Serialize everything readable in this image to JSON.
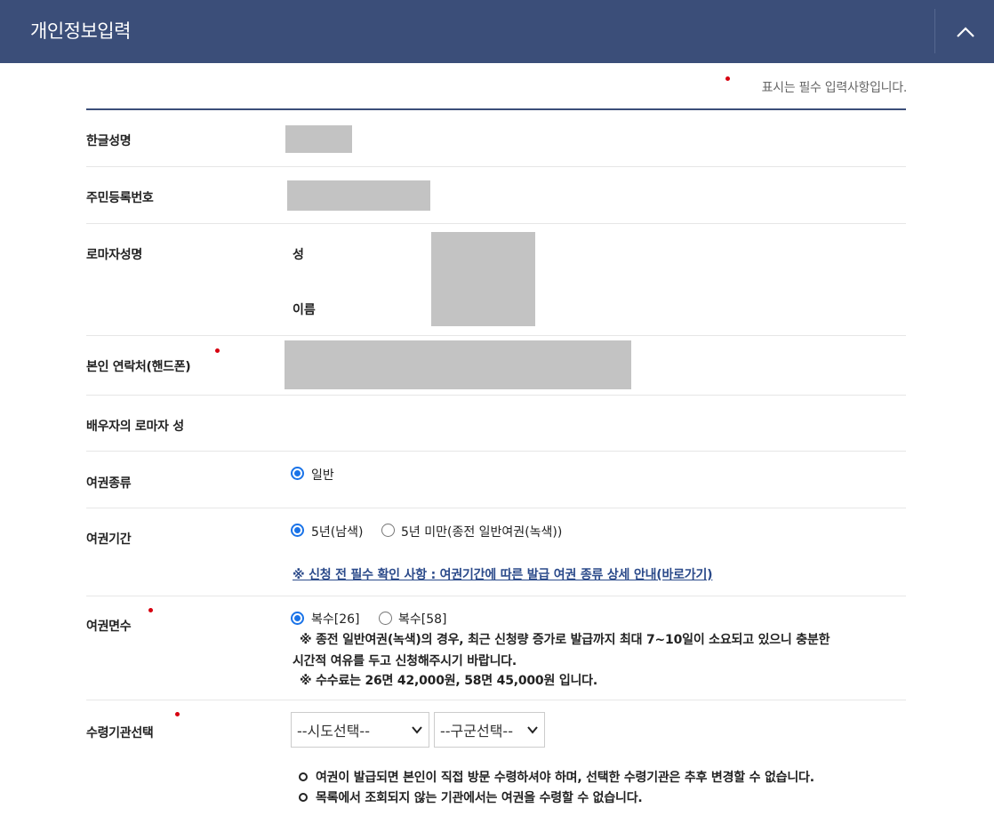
{
  "header": {
    "title": "개인정보입력"
  },
  "required_note": "표시는 필수 입력사항입니다.",
  "fields": {
    "korean_name": {
      "label": "한글성명"
    },
    "resident_number": {
      "label": "주민등록번호"
    },
    "roman_name": {
      "label": "로마자성명",
      "surname_label": "성",
      "given_label": "이름"
    },
    "phone": {
      "label": "본인 연락처(핸드폰)"
    },
    "spouse_surname": {
      "label": "배우자의 로마자 성"
    },
    "passport_type": {
      "label": "여권종류",
      "options": [
        {
          "label": "일반",
          "selected": true
        }
      ]
    },
    "passport_period": {
      "label": "여권기간",
      "options": [
        {
          "label": "5년(남색)",
          "selected": true
        },
        {
          "label": "5년 미만(종전 일반여권(녹색))",
          "selected": false
        }
      ],
      "link": "※ 신청 전 필수 확인 사항 : 여권기간에 따른 발급 여권 종류 상세 안내(바로가기)"
    },
    "page_count": {
      "label": "여권면수",
      "options": [
        {
          "label": "복수[26]",
          "selected": true
        },
        {
          "label": "복수[58]",
          "selected": false
        }
      ],
      "notes": [
        "※ 종전 일반여권(녹색)의 경우, 최근 신청량 증가로 발급까지 최대 7~10일이 소요되고 있으니 충분한",
        "시간적 여유를 두고 신청해주시기 바랍니다.",
        "※ 수수료는 26면 42,000원, 58면 45,000원 입니다."
      ]
    },
    "pickup_office": {
      "label": "수령기관선택",
      "city_select": "--시도선택--",
      "district_select": "--구군선택--",
      "bullets": [
        "여권이 발급되면 본인이 직접 방문 수령하셔야 하며, 선택한 수령기관은 추후 변경할 수 없습니다.",
        "목록에서 조회되지 않는 기관에서는 여권을 수령할 수 없습니다."
      ]
    }
  },
  "colors": {
    "header_bg": "#3b4e79",
    "required_dot": "#d7000f",
    "radio_accent": "#1a73e8",
    "link": "#2b4a8a"
  },
  "icons": {
    "collapse": "chevron-up-icon"
  }
}
